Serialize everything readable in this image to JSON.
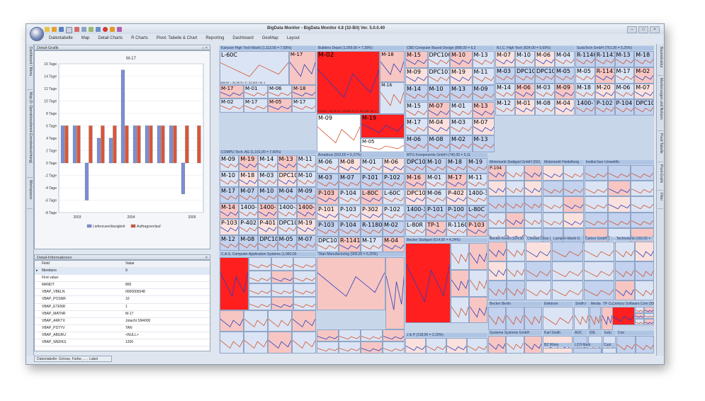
{
  "app": {
    "title": "BigData Monitor - BigData Monitor 4.8 (32-Bit) Ver. 5.0.0.40",
    "menu": [
      "Datentabelle",
      "Map",
      "Detail Charts",
      "R Charts",
      "Pivot: Tabelle & Chart",
      "Reporting",
      "Dashboard",
      "GeoMap",
      "Layout"
    ]
  },
  "left_tabs": [
    "Dashboard / Menu",
    "Map (0: Operationsdienst-Grenzbeleuchtung)",
    "Workspaces"
  ],
  "right_tabs": [
    "Baumstruktur",
    "Markierungen und Notizen",
    "Pivot-Tabelle",
    "Pivot-Grafik",
    "Filter"
  ],
  "chart_panel": {
    "header": "Detail-Grafik",
    "pin": "↕ ×",
    "chart_data": {
      "type": "bar",
      "title": "M-17",
      "categories": [
        "2003",
        "2004",
        "2005"
      ],
      "yticks": [
        "16 Tage",
        "14 Tage",
        "12 Tage",
        "10 Tage",
        "8 Tage",
        "6 Tage",
        "4 Tage",
        "2 Tage",
        "0 Tage",
        "-2 Tage",
        "-4 Tage",
        "-6 Tage",
        "-8 Tage"
      ],
      "ylim": [
        -8,
        16
      ],
      "series": [
        {
          "name": "Lieferzuverlässigkeit",
          "color": "#7b8fd6",
          "values": [
            6,
            6,
            -6,
            4,
            4,
            15,
            6,
            6,
            6,
            6,
            -5,
            0
          ]
        },
        {
          "name": "Auftragsvorlauf",
          "color": "#d9553a",
          "values": [
            6,
            6,
            6,
            6,
            6,
            6,
            6,
            6,
            6,
            6,
            6,
            6
          ]
        }
      ],
      "grid": true,
      "legend": "bottom"
    }
  },
  "detail_panel": {
    "header": "Detail-Informationen",
    "columns": [
      "Field",
      "Value"
    ],
    "rows": [
      [
        "Members",
        "9"
      ],
      [
        "First value:",
        ""
      ],
      [
        "MANDT",
        "800"
      ],
      [
        "VBAP_VBELN",
        "0000005648"
      ],
      [
        "VBAP_POSNR",
        "10"
      ],
      [
        "VBAP_ETENR",
        "1"
      ],
      [
        "VBAP_MATNR",
        "M-17"
      ],
      [
        "VBAP_ARKTX",
        "Jotachi SN4000"
      ],
      [
        "VBAP_PSTYV",
        "TAN"
      ],
      [
        "VBAP_ABGRU",
        "<NULL>"
      ],
      [
        "VBAP_WERKS",
        "1200"
      ]
    ]
  },
  "status": {
    "text": "Datentabelle: Grösse, Farbe, ... , Label"
  },
  "treemap": {
    "groups": [
      {
        "label": "Karsson High Tech Markt (1,113,00 = 7,69%)"
      },
      {
        "label": "Builders Depot (1,069,00 = 7,38%)"
      },
      {
        "label": "CBD Computer Based Design (898,00 = 6,2"
      },
      {
        "label": "N.I.C. High Tech (824,00 = 5,69%)"
      },
      {
        "label": "SudaTech GmbH (761,00 = 5,25%)"
      },
      {
        "label": "COMPU Tech. AG (1,101,00 = 7,60%)"
      },
      {
        "label": "Amadeus (923,00 = 6,37%)"
      },
      {
        "label": "MTG Komponente GmbH (740,00 = 5,11"
      },
      {
        "label": "Motomarkt Stuttgart GmbH (562,"
      },
      {
        "label": "Motomarkt Heidelberg"
      },
      {
        "label": "Institut fuer Umweltfo"
      },
      {
        "label": "C.A.S. Computer Application Systems (1,082,00"
      },
      {
        "label": "Titan Manufacturing (905,00 = 6,25%)"
      },
      {
        "label": "Becker Stuttgart (614,00 = 4,24%)"
      },
      {
        "label": "Becker Koeln (324,00 = 2,"
      },
      {
        "label": "Christal Clear (1"
      },
      {
        "label": "Lampen-Markt G"
      },
      {
        "label": "Carbor GmbH ("
      },
      {
        "label": "Technoland (160,00 ="
      },
      {
        "label": "Omega Soft"
      },
      {
        "label": "Century Software.Com (590,00 = 4,07"
      },
      {
        "label": "J & P (318,00 = 2,20%)"
      },
      {
        "label": "Becker Berlin"
      },
      {
        "label": "Elektrom"
      },
      {
        "label": "Smith I"
      },
      {
        "label": "Media"
      },
      {
        "label": "TP Cu"
      },
      {
        "label": "Karl Smith"
      },
      {
        "label": "ADC"
      },
      {
        "label": "IDE"
      },
      {
        "label": "Indu"
      },
      {
        "label": "Con"
      },
      {
        "label": "Systeme Systeme GmbH"
      },
      {
        "label": "BZ Wires"
      },
      {
        "label": "LCH Mark"
      },
      {
        "label": "Cust"
      }
    ],
    "karsson_caption": "288,00 = 34,38 % / C: 22,819 / M: 1",
    "builders_caption": "579,00 = 54,16 % / 4,6284 % / C: 64,135 / M: 1",
    "cells": [
      "L-60C",
      "M-17",
      "M-17",
      "M-01",
      "M-06",
      "M-18",
      "M-02",
      "M-17",
      "M-05",
      "M-17",
      "M-02",
      "M-18",
      "M-16",
      "M-09",
      "M-19",
      "M-05",
      "M-15",
      "DPC1002",
      "M-10",
      "M-13",
      "M-09",
      "DPC1015",
      "M-19",
      "M-11",
      "M-14",
      "M-10",
      "M-13",
      "M-09",
      "M-15",
      "M-07",
      "M-01",
      "M-13",
      "M-17",
      "M-04",
      "M-03",
      "M-07",
      "M-06",
      "M-08",
      "M-02",
      "M-13",
      "M-07",
      "M-10",
      "M-06",
      "M-04",
      "M-03",
      "DPC1013",
      "DPC1009",
      "M-05",
      "M-14",
      "M-06",
      "M-03",
      "M-09",
      "M-12",
      "M-01",
      "M-08",
      "M-04",
      "R-1140",
      "R-1141",
      "M-13",
      "M-18",
      "M-05",
      "R-1141",
      "M-17",
      "M-02",
      "M-18",
      "M-20",
      "M-06",
      "M-07",
      "1400-750",
      "P-102",
      "P-104",
      "DPC1019",
      "M-09",
      "M-19",
      "M-14",
      "M-13",
      "M-11",
      "M-10",
      "M-18",
      "M-03",
      "DPC1020",
      "M-10",
      "M-17",
      "M-07",
      "M-10",
      "M-04",
      "M-09",
      "M-14",
      "1400-200",
      "1400-100",
      "1400-250",
      "1400-300",
      "P-103",
      "P-402",
      "P-401",
      "DPC1009",
      "M-19",
      "M-12",
      "M-08",
      "DPC1025",
      "M-05",
      "M-07",
      "M-06",
      "M-08",
      "M-01",
      "M-06",
      "M-03",
      "M-07",
      "P-101",
      "P-102",
      "P-103",
      "P-104",
      "L-80C",
      "L-60C",
      "P-101",
      "P-103",
      "P-302",
      "P-102",
      "P-103",
      "P-104",
      "R-1180",
      "M-02",
      "DPC1017",
      "R-1141",
      "M-17",
      "M-04",
      "DPC1013",
      "M-10",
      "M-18",
      "M-19",
      "M-16",
      "M-01",
      "M-17",
      "M-11",
      "DPC1016",
      "M-06",
      "P-402",
      "1400-300",
      "1400-310",
      "P-101",
      "P-100",
      "L-80C",
      "L-80R",
      "TP-1",
      "R-1160",
      "P-103",
      "P-104"
    ]
  }
}
